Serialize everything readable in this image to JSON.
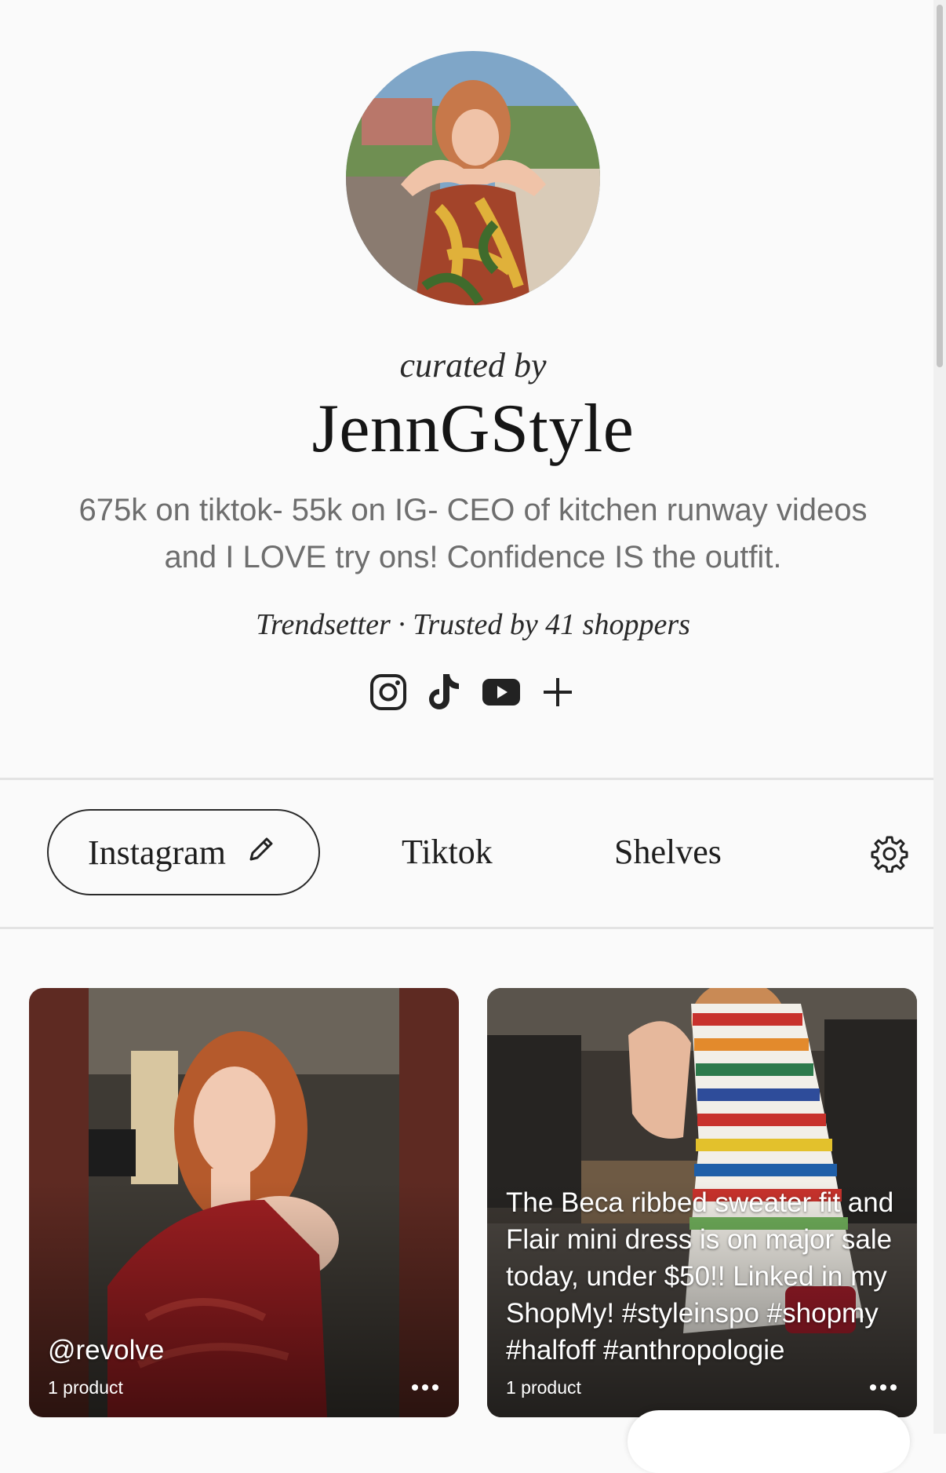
{
  "profile": {
    "curated_label": "curated by",
    "name": "JennGStyle",
    "bio": "675k on tiktok- 55k on IG- CEO of kitchen runway videos and I LOVE try ons! Confidence IS the outfit.",
    "tier": "Trendsetter",
    "separator": "·",
    "trusted": "Trusted by 41 shoppers",
    "socials": [
      "instagram-icon",
      "tiktok-icon",
      "youtube-icon",
      "plus-icon"
    ]
  },
  "tabs": {
    "active": "Instagram",
    "items": [
      "Instagram",
      "Tiktok",
      "Shelves"
    ]
  },
  "posts": [
    {
      "caption": "@revolve",
      "product_count": "1 product"
    },
    {
      "caption": "The Beca ribbed sweater fit and Flair mini dress is on major sale today, under $50!! Linked in my ShopMy! #styleinspo #shopmy #halfoff #anthropologie",
      "product_count": "1 product"
    }
  ],
  "colors": {
    "background": "#fafafa",
    "text": "#1e1e1e",
    "muted": "#6e6e6e",
    "divider": "#e3e3e3"
  }
}
